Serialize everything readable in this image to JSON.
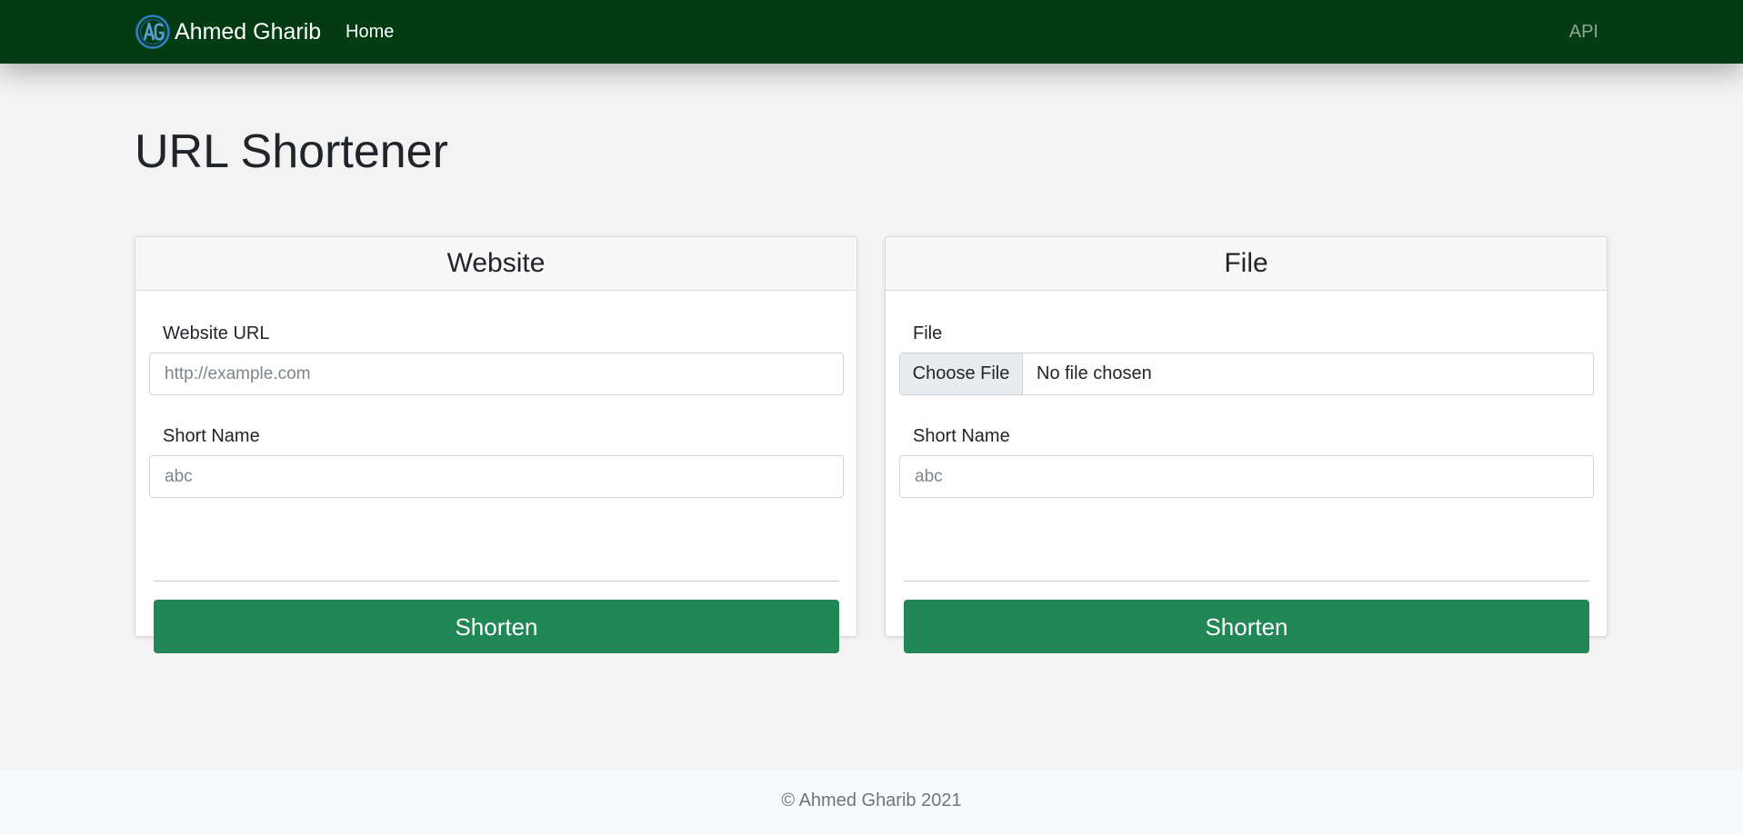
{
  "navbar": {
    "brand": "Ahmed Gharib",
    "home": "Home",
    "api": "API"
  },
  "page": {
    "title": "URL Shortener"
  },
  "website_card": {
    "header": "Website",
    "url_label": "Website URL",
    "url_placeholder": "http://example.com",
    "url_value": "",
    "short_label": "Short Name",
    "short_placeholder": "abc",
    "short_value": "",
    "button": "Shorten"
  },
  "file_card": {
    "header": "File",
    "file_label": "File",
    "file_button": "Choose File",
    "file_status": "No file chosen",
    "short_label": "Short Name",
    "short_placeholder": "abc",
    "short_value": "",
    "button": "Shorten"
  },
  "footer": {
    "text": "© Ahmed Gharib 2021"
  },
  "colors": {
    "navbar": "#033b12",
    "button": "#218757",
    "page_background": "#f3f3f3",
    "footer_background": "#f8f9fa"
  },
  "icons": {
    "brand_logo": "ag-monogram-logo"
  }
}
